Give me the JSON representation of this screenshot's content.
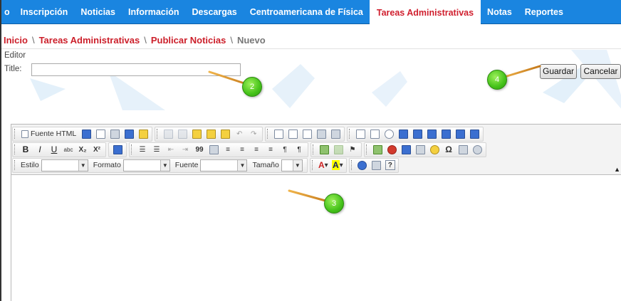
{
  "nav": {
    "items": [
      {
        "label": "o",
        "active": false
      },
      {
        "label": "Inscripción",
        "active": false
      },
      {
        "label": "Noticias",
        "active": false
      },
      {
        "label": "Información",
        "active": false
      },
      {
        "label": "Descargas",
        "active": false
      },
      {
        "label": "Centroamericana de Física",
        "active": false
      },
      {
        "label": "Tareas Administrativas",
        "active": true
      },
      {
        "label": "Notas",
        "active": false
      },
      {
        "label": "Reportes",
        "active": false
      }
    ]
  },
  "breadcrumb": {
    "items": [
      "Inicio",
      "Tareas Administrativas",
      "Publicar Noticias"
    ],
    "separator": "\\",
    "current": "Nuevo"
  },
  "form": {
    "editor_label": "Editor",
    "title_label": "Title:",
    "title_value": ""
  },
  "actions": {
    "save_label": "Guardar",
    "cancel_label": "Cancelar"
  },
  "callouts": [
    "2",
    "3",
    "4"
  ],
  "toolbar": {
    "source_label": "Fuente HTML",
    "style_label": "Estilo",
    "format_label": "Formato",
    "font_label": "Fuente",
    "size_label": "Tamaño",
    "bold": "B",
    "italic": "I",
    "underline": "U",
    "strike": "abc",
    "subscript": "X₂",
    "superscript": "X²",
    "quote": "99",
    "omega": "Ω",
    "help": "?",
    "collapse": "▲"
  },
  "colors": {
    "nav_bg": "#1a85e0",
    "accent_red": "#cc1f2a",
    "callout_green": "#45c21a",
    "leader_orange": "#e49b2a"
  }
}
